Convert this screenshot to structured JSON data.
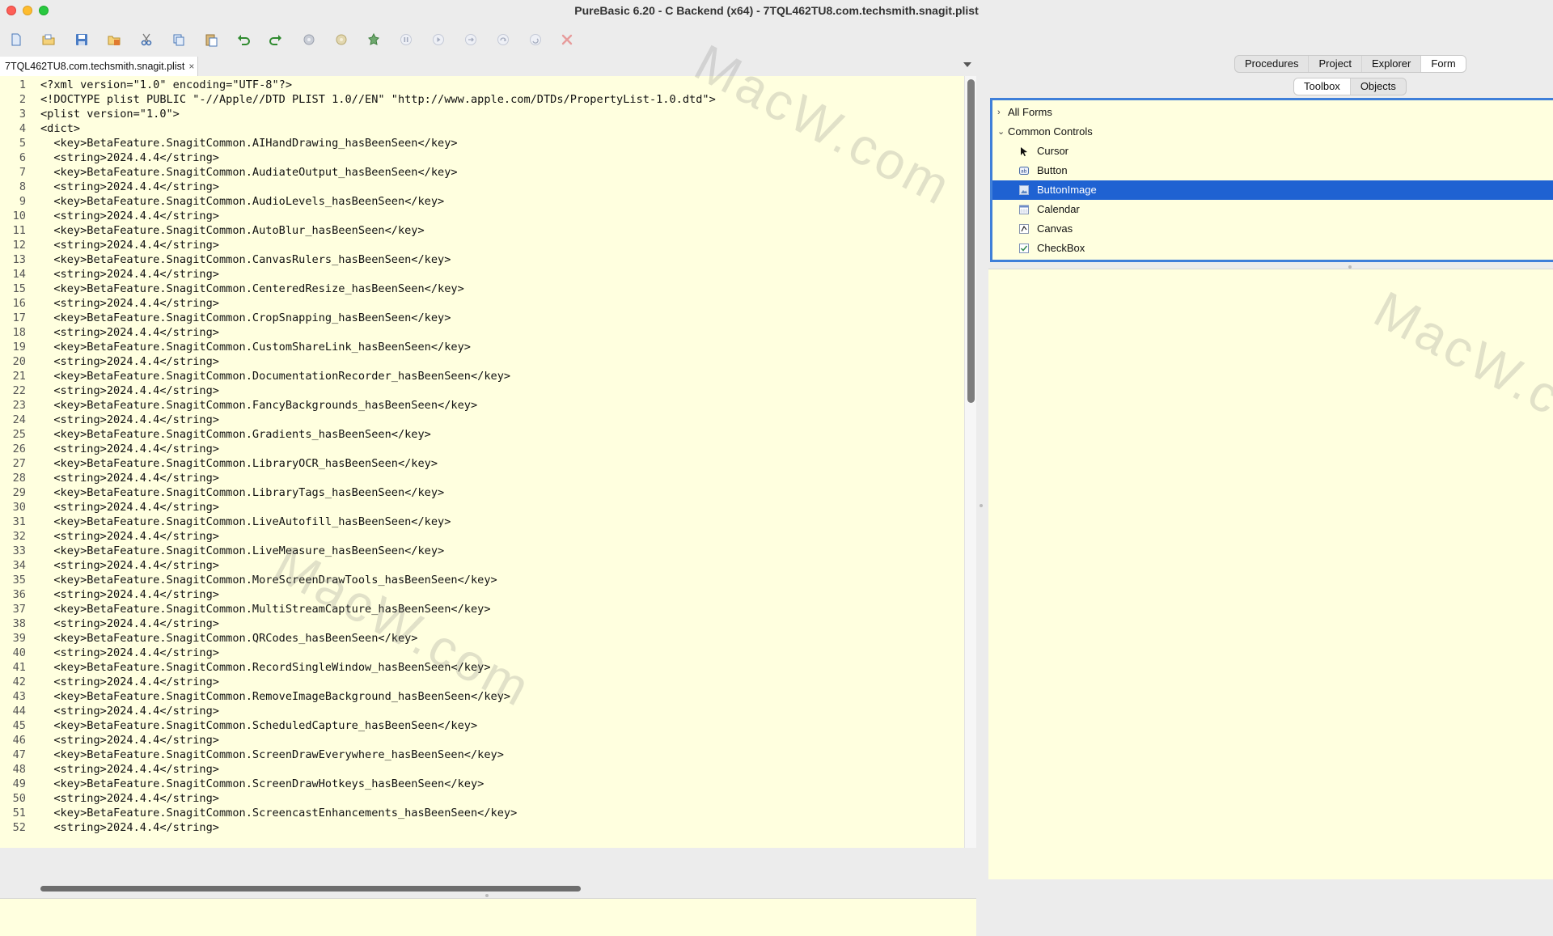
{
  "window": {
    "title": "PureBasic 6.20 - C Backend (x64) - 7TQL462TU8.com.techsmith.snagit.plist"
  },
  "toolbar": {
    "buttons": [
      "new-file-icon",
      "open-file-icon",
      "save-icon",
      "save-all-icon",
      "cut-icon",
      "copy-icon",
      "paste-icon",
      "undo-icon",
      "redo-icon",
      "compile-icon",
      "debug-icon",
      "build-icon",
      "pause-icon",
      "continue-icon",
      "step-icon",
      "step-over-icon",
      "step-out-icon",
      "kill-icon"
    ]
  },
  "editor": {
    "tab_title": "7TQL462TU8.com.techsmith.snagit.plist",
    "tab_close": "×",
    "lines": [
      "<?xml version=\"1.0\" encoding=\"UTF-8\"?>",
      "<!DOCTYPE plist PUBLIC \"-//Apple//DTD PLIST 1.0//EN\" \"http://www.apple.com/DTDs/PropertyList-1.0.dtd\">",
      "<plist version=\"1.0\">",
      "<dict>",
      "  <key>BetaFeature.SnagitCommon.AIHandDrawing_hasBeenSeen</key>",
      "  <string>2024.4.4</string>",
      "  <key>BetaFeature.SnagitCommon.AudiateOutput_hasBeenSeen</key>",
      "  <string>2024.4.4</string>",
      "  <key>BetaFeature.SnagitCommon.AudioLevels_hasBeenSeen</key>",
      "  <string>2024.4.4</string>",
      "  <key>BetaFeature.SnagitCommon.AutoBlur_hasBeenSeen</key>",
      "  <string>2024.4.4</string>",
      "  <key>BetaFeature.SnagitCommon.CanvasRulers_hasBeenSeen</key>",
      "  <string>2024.4.4</string>",
      "  <key>BetaFeature.SnagitCommon.CenteredResize_hasBeenSeen</key>",
      "  <string>2024.4.4</string>",
      "  <key>BetaFeature.SnagitCommon.CropSnapping_hasBeenSeen</key>",
      "  <string>2024.4.4</string>",
      "  <key>BetaFeature.SnagitCommon.CustomShareLink_hasBeenSeen</key>",
      "  <string>2024.4.4</string>",
      "  <key>BetaFeature.SnagitCommon.DocumentationRecorder_hasBeenSeen</key>",
      "  <string>2024.4.4</string>",
      "  <key>BetaFeature.SnagitCommon.FancyBackgrounds_hasBeenSeen</key>",
      "  <string>2024.4.4</string>",
      "  <key>BetaFeature.SnagitCommon.Gradients_hasBeenSeen</key>",
      "  <string>2024.4.4</string>",
      "  <key>BetaFeature.SnagitCommon.LibraryOCR_hasBeenSeen</key>",
      "  <string>2024.4.4</string>",
      "  <key>BetaFeature.SnagitCommon.LibraryTags_hasBeenSeen</key>",
      "  <string>2024.4.4</string>",
      "  <key>BetaFeature.SnagitCommon.LiveAutofill_hasBeenSeen</key>",
      "  <string>2024.4.4</string>",
      "  <key>BetaFeature.SnagitCommon.LiveMeasure_hasBeenSeen</key>",
      "  <string>2024.4.4</string>",
      "  <key>BetaFeature.SnagitCommon.MoreScreenDrawTools_hasBeenSeen</key>",
      "  <string>2024.4.4</string>",
      "  <key>BetaFeature.SnagitCommon.MultiStreamCapture_hasBeenSeen</key>",
      "  <string>2024.4.4</string>",
      "  <key>BetaFeature.SnagitCommon.QRCodes_hasBeenSeen</key>",
      "  <string>2024.4.4</string>",
      "  <key>BetaFeature.SnagitCommon.RecordSingleWindow_hasBeenSeen</key>",
      "  <string>2024.4.4</string>",
      "  <key>BetaFeature.SnagitCommon.RemoveImageBackground_hasBeenSeen</key>",
      "  <string>2024.4.4</string>",
      "  <key>BetaFeature.SnagitCommon.ScheduledCapture_hasBeenSeen</key>",
      "  <string>2024.4.4</string>",
      "  <key>BetaFeature.SnagitCommon.ScreenDrawEverywhere_hasBeenSeen</key>",
      "  <string>2024.4.4</string>",
      "  <key>BetaFeature.SnagitCommon.ScreenDrawHotkeys_hasBeenSeen</key>",
      "  <string>2024.4.4</string>",
      "  <key>BetaFeature.SnagitCommon.ScreencastEnhancements_hasBeenSeen</key>",
      "  <string>2024.4.4</string>"
    ]
  },
  "right_panel": {
    "tabs": [
      {
        "label": "Procedures",
        "active": false
      },
      {
        "label": "Project",
        "active": false
      },
      {
        "label": "Explorer",
        "active": false
      },
      {
        "label": "Form",
        "active": true
      }
    ],
    "subtabs": [
      {
        "label": "Toolbox",
        "active": true
      },
      {
        "label": "Objects",
        "active": false
      }
    ],
    "tree": {
      "all_forms": "All Forms",
      "common_controls": "Common Controls",
      "controls": [
        {
          "label": "Cursor",
          "icon": "cursor-icon",
          "selected": false
        },
        {
          "label": "Button",
          "icon": "button-icon",
          "selected": false
        },
        {
          "label": "ButtonImage",
          "icon": "button-image-icon",
          "selected": true
        },
        {
          "label": "Calendar",
          "icon": "calendar-icon",
          "selected": false
        },
        {
          "label": "Canvas",
          "icon": "canvas-icon",
          "selected": false
        },
        {
          "label": "CheckBox",
          "icon": "checkbox-icon",
          "selected": false
        }
      ]
    }
  },
  "watermark": "MacW.com",
  "colors": {
    "editor_bg": "#ffffdf",
    "selection": "#1f62d2",
    "focus_border": "#3f7fd9"
  }
}
